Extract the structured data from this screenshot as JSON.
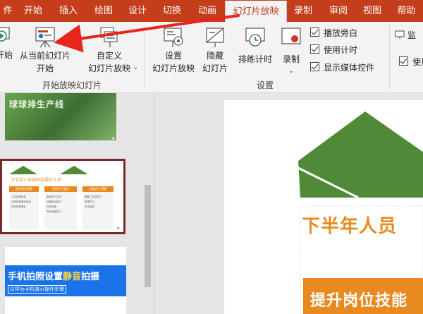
{
  "ribbon_tabs": [
    {
      "label": "件"
    },
    {
      "label": "开始"
    },
    {
      "label": "插入"
    },
    {
      "label": "绘图"
    },
    {
      "label": "设计"
    },
    {
      "label": "切换"
    },
    {
      "label": "动画"
    },
    {
      "label": "幻灯片放映"
    },
    {
      "label": "录制"
    },
    {
      "label": "审阅"
    },
    {
      "label": "视图"
    },
    {
      "label": "帮助"
    }
  ],
  "start_group": {
    "from_beginning_label": "开始",
    "from_current_line1": "从当前幻灯片",
    "from_current_line2": "开始",
    "custom_line1": "自定义",
    "custom_line2": "幻灯片放映",
    "group_label": "开始放映幻灯片"
  },
  "setup_group": {
    "setup_line1": "设置",
    "setup_line2": "幻灯片放映",
    "hide_line1": "隐藏",
    "hide_line2": "幻灯片",
    "rehearse_label": "排练计时",
    "record_label": "录制",
    "record_arrow": "⌄",
    "checkboxes": [
      {
        "label": "播放旁白",
        "checked": true
      },
      {
        "label": "使用计时",
        "checked": true
      },
      {
        "label": "显示媒体控件",
        "checked": true
      }
    ],
    "group_label": "设置"
  },
  "monitor_group": {
    "monitor_label": "监",
    "use_label": "使用"
  },
  "thumbnails": {
    "slide_a_text": "球球排生产线",
    "slide_b_title": "下半年人员架构及提升工作",
    "slide_b_col_headers": [
      "提升岗位技能",
      "提高员工能力",
      "拓展员工视野"
    ],
    "slide_b_items": [
      [
        "人员结构优化",
        "业务技能提升培训",
        "岗位责任落实"
      ],
      [
        "组织学习交流",
        "加强综合能力",
        "业务讲座",
        "专业技能学习"
      ],
      [
        "跨部门交流学习",
        "参观学习",
        "外出培训"
      ]
    ],
    "slide_c_title_part1": "手机拍照设置",
    "slide_c_title_highlight": "静音",
    "slide_c_title_part2": "拍摄",
    "slide_c_subtitle": "以华为手机演示操作步骤"
  },
  "main_slide": {
    "title": "下半年人员",
    "subtitle": "提升岗位技能"
  },
  "colors": {
    "brand_red": "#c43e1c",
    "slide_green": "#4f8a36",
    "slide_orange": "#e88a1f",
    "slide_blue": "#1a73e8",
    "annotation_red": "#e8241c"
  }
}
